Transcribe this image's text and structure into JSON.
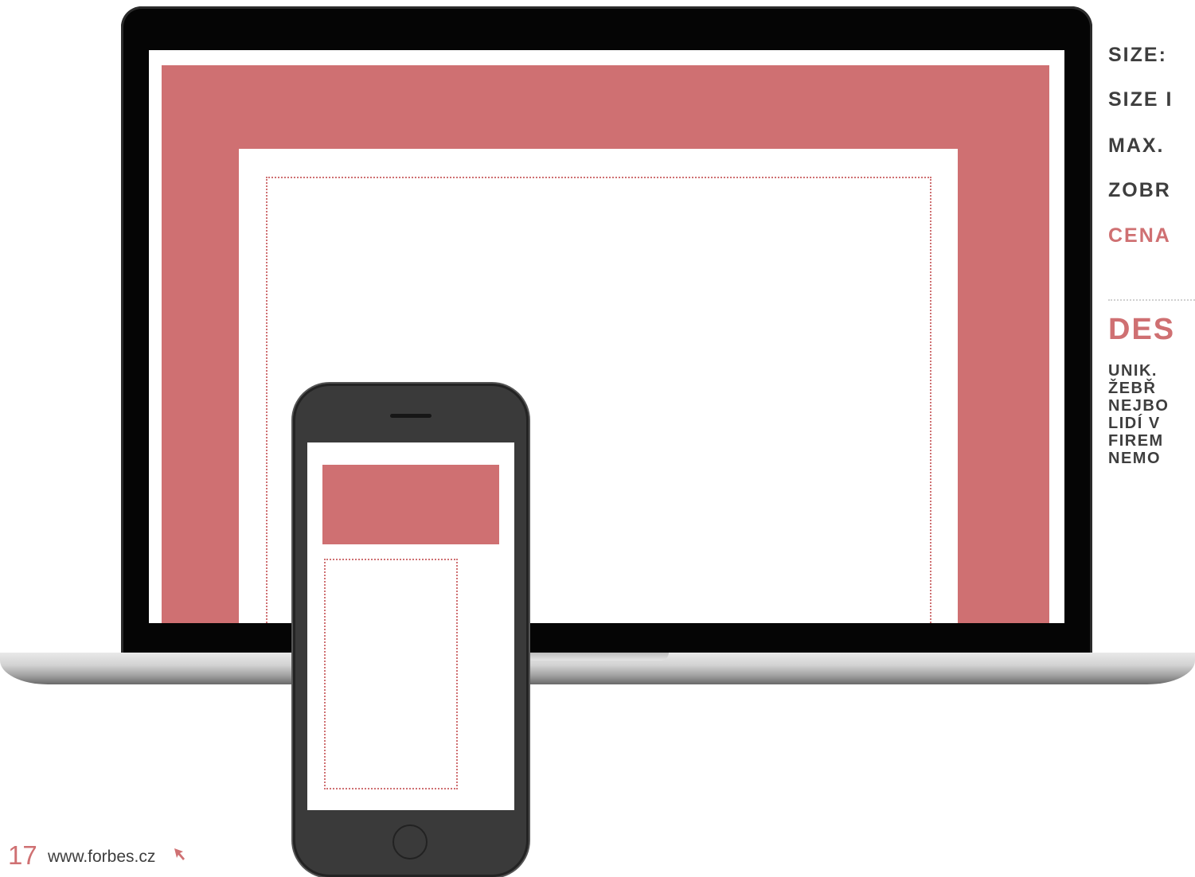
{
  "specs": [
    {
      "text": "SIZE:"
    },
    {
      "text": "SIZE I"
    },
    {
      "text": "MAX."
    },
    {
      "text": "ZOBR"
    },
    {
      "text": "CENA"
    }
  ],
  "description": {
    "title": "DES",
    "lines": [
      "UNIK.",
      "ŽEBŘ",
      "NEJBO",
      "LIDÍ V",
      "FIREM",
      "NEMO"
    ]
  },
  "footer": {
    "page_number": "17",
    "url": "www.forbes.cz",
    "arrow_icon": "cursor-arrow-icon"
  },
  "colors": {
    "accent": "#cf7072",
    "text": "#3e3e3e"
  }
}
